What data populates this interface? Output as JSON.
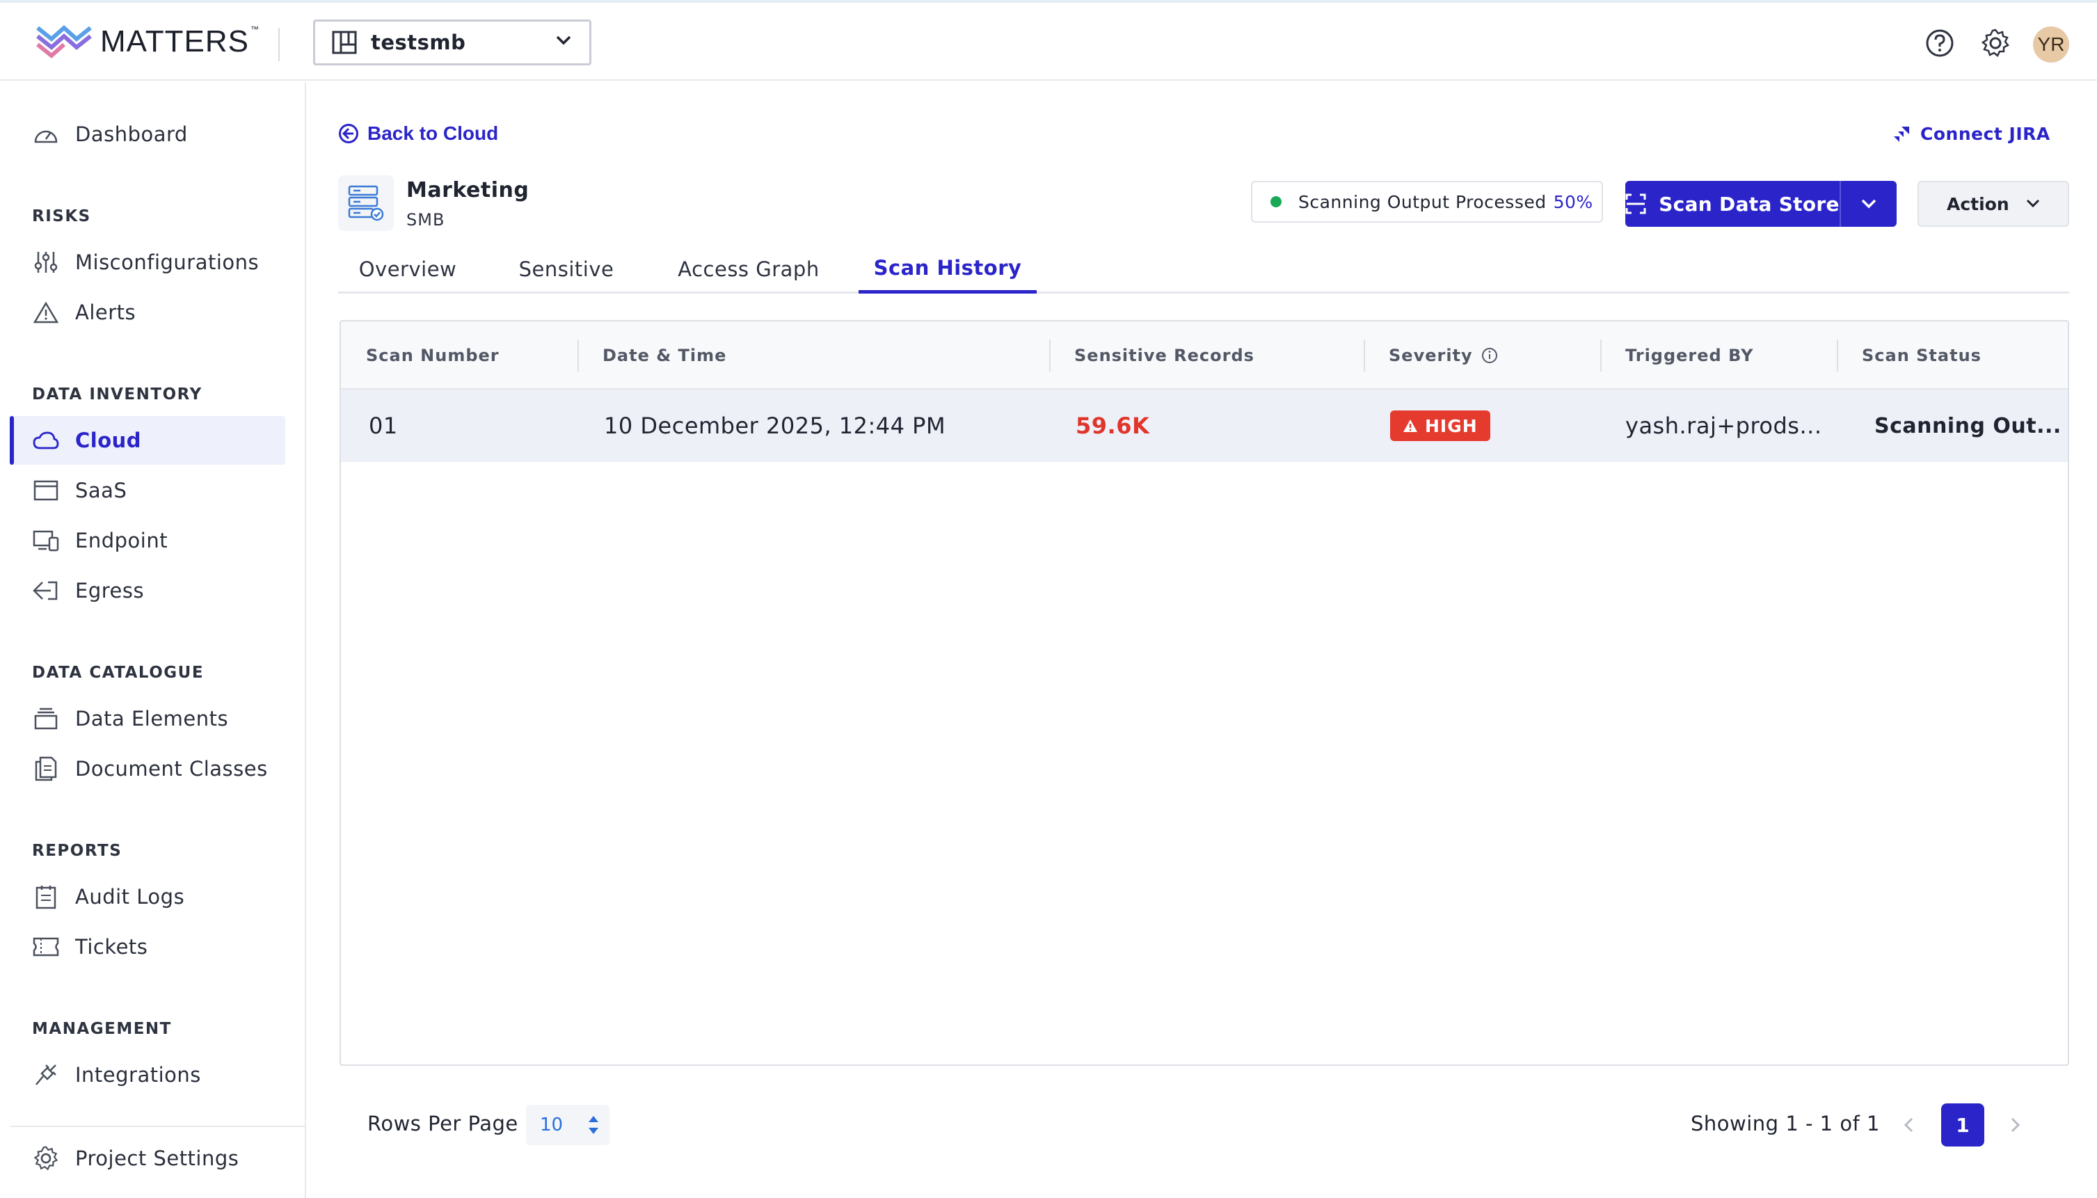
{
  "brand": {
    "name": "MATTERS",
    "tm": "™"
  },
  "header": {
    "project": "testsmb",
    "avatar_initials": "YR"
  },
  "sidebar": {
    "dashboard": "Dashboard",
    "sections": {
      "risks": "RISKS",
      "data_inventory": "DATA INVENTORY",
      "data_catalogue": "DATA CATALOGUE",
      "reports": "REPORTS",
      "management": "MANAGEMENT"
    },
    "items": {
      "misconfigurations": "Misconfigurations",
      "alerts": "Alerts",
      "cloud": "Cloud",
      "saas": "SaaS",
      "endpoint": "Endpoint",
      "egress": "Egress",
      "data_elements": "Data Elements",
      "document_classes": "Document Classes",
      "audit_logs": "Audit Logs",
      "tickets": "Tickets",
      "integrations": "Integrations",
      "project_settings": "Project Settings"
    }
  },
  "main": {
    "back_label": "Back to Cloud",
    "connect_jira": "Connect JIRA",
    "store": {
      "name": "Marketing",
      "type": "SMB"
    },
    "status": {
      "text": "Scanning Output Processed",
      "percent": "50%"
    },
    "scan_button": "Scan Data Store",
    "action_button": "Action",
    "tabs": [
      "Overview",
      "Sensitive",
      "Access Graph",
      "Scan History"
    ],
    "active_tab": "Scan History"
  },
  "table": {
    "columns": [
      "Scan Number",
      "Date & Time",
      "Sensitive Records",
      "Severity",
      "Triggered BY",
      "Scan Status"
    ],
    "rows": [
      {
        "scan_number": "01",
        "date_time": "10 December 2025, 12:44 PM",
        "sensitive_records": "59.6K",
        "severity": "HIGH",
        "triggered_by": "yash.raj+prods...",
        "scan_status": "Scanning Out..."
      }
    ]
  },
  "pagination": {
    "rows_per_page_label": "Rows Per Page",
    "rows_per_page": "10",
    "showing": "Showing 1 - 1 of 1",
    "current_page": "1"
  },
  "colors": {
    "accent": "#2a24c9",
    "high": "#e53a2e",
    "status_dot": "#18a957"
  }
}
